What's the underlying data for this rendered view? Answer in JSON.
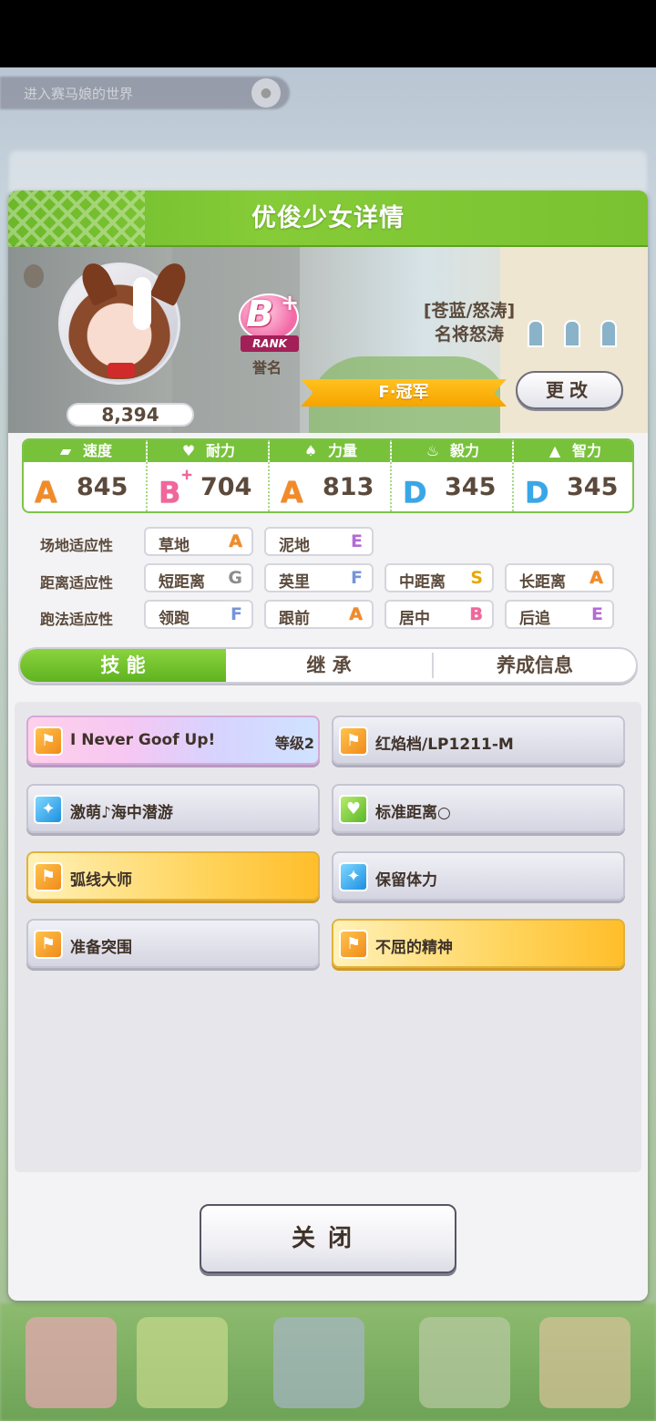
{
  "background": {
    "pill_text": "进入赛马娘的世界"
  },
  "dialog": {
    "title": "优俊少女详情"
  },
  "profile": {
    "fans": "8,394",
    "rank_letter": "B",
    "rank_plus": "+",
    "rank_label": "RANK",
    "rank_caption": "誉名",
    "epithet_line1": "[苍蓝/怒涛]",
    "epithet_line2": "名将怒涛",
    "title_badge": "F·冠军",
    "change_button": "更改"
  },
  "stats": [
    {
      "icon": "shoe-icon",
      "name": "速度",
      "grade": "A",
      "grade_plus": "",
      "value": "845",
      "color": "A"
    },
    {
      "icon": "heart-icon",
      "name": "耐力",
      "grade": "B",
      "grade_plus": "+",
      "value": "704",
      "color": "B"
    },
    {
      "icon": "muscle-icon",
      "name": "力量",
      "grade": "A",
      "grade_plus": "",
      "value": "813",
      "color": "A"
    },
    {
      "icon": "flame-icon",
      "name": "毅力",
      "grade": "D",
      "grade_plus": "",
      "value": "345",
      "color": "D"
    },
    {
      "icon": "graduation-cap-icon",
      "name": "智力",
      "grade": "D",
      "grade_plus": "",
      "value": "345",
      "color": "D"
    }
  ],
  "aptitude": {
    "track_label": "场地适应性",
    "distance_label": "距离适应性",
    "style_label": "跑法适应性",
    "track": [
      {
        "name": "草地",
        "grade": "A"
      },
      {
        "name": "泥地",
        "grade": "E"
      }
    ],
    "distance": [
      {
        "name": "短距离",
        "grade": "G"
      },
      {
        "name": "英里",
        "grade": "F"
      },
      {
        "name": "中距离",
        "grade": "S"
      },
      {
        "name": "长距离",
        "grade": "A"
      }
    ],
    "style": [
      {
        "name": "领跑",
        "grade": "F"
      },
      {
        "name": "跟前",
        "grade": "A"
      },
      {
        "name": "居中",
        "grade": "B"
      },
      {
        "name": "后追",
        "grade": "E"
      }
    ]
  },
  "tabs": [
    {
      "label": "技 能",
      "active": true
    },
    {
      "label": "继 承",
      "active": false
    },
    {
      "label": "养成信息",
      "active": false
    }
  ],
  "skills": [
    {
      "name": "I Never Goof Up!",
      "level": "等级2",
      "style": "rainbow",
      "icon": "running-figure-icon",
      "icon_color": "orange"
    },
    {
      "name": "红焰档/LP1211-M",
      "level": "",
      "style": "plain",
      "icon": "running-figure-icon",
      "icon_color": "orange"
    },
    {
      "name": "激萌♪海中潜游",
      "level": "",
      "style": "plain",
      "icon": "sparkle-icon",
      "icon_color": "blue"
    },
    {
      "name": "标准距离○",
      "level": "",
      "style": "plain",
      "icon": "heart-icon",
      "icon_color": "green"
    },
    {
      "name": "弧线大师",
      "level": "",
      "style": "gold",
      "icon": "running-figure-icon",
      "icon_color": "orange"
    },
    {
      "name": "保留体力",
      "level": "",
      "style": "plain",
      "icon": "sparkle-icon",
      "icon_color": "blue"
    },
    {
      "name": "准备突围",
      "level": "",
      "style": "plain",
      "icon": "running-figure-icon",
      "icon_color": "orange"
    },
    {
      "name": "不屈的精神",
      "level": "",
      "style": "gold",
      "icon": "running-figure-icon",
      "icon_color": "orange"
    }
  ],
  "close_button": "关闭"
}
